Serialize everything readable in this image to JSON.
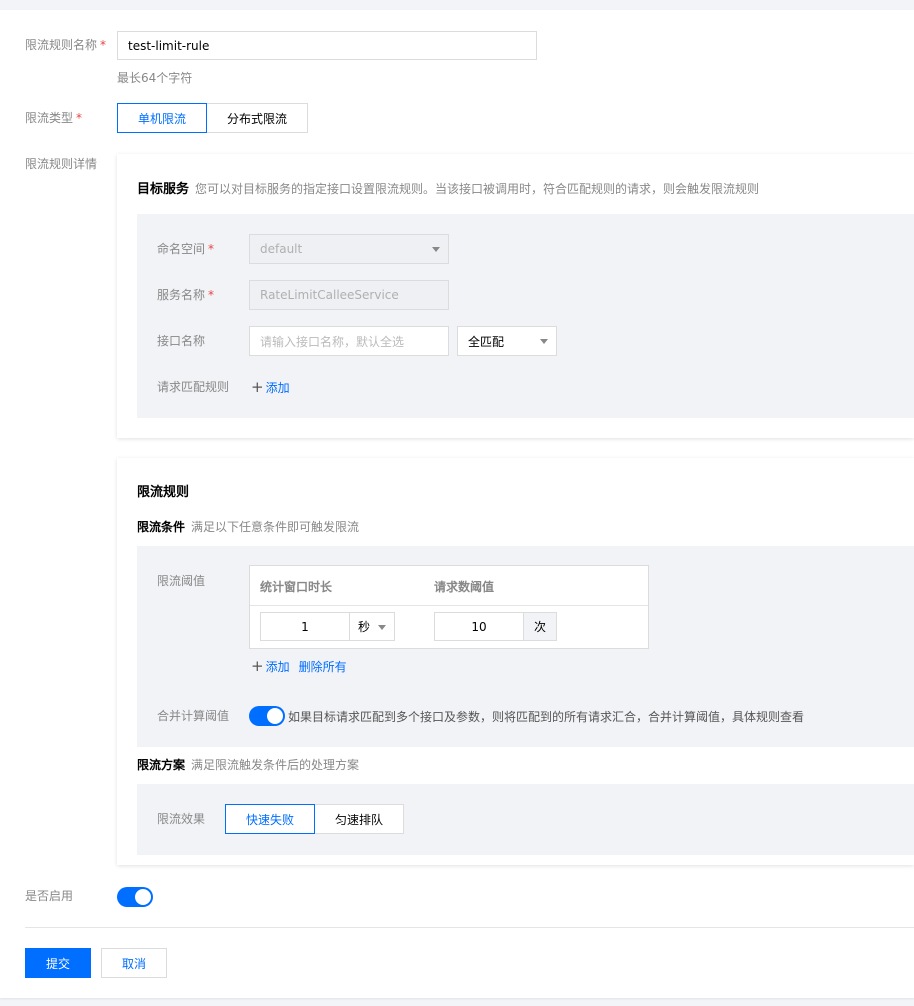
{
  "form": {
    "rule_name_label": "限流规则名称",
    "required_mark": "*",
    "rule_name_value": "test-limit-rule",
    "rule_name_hint": "最长64个字符",
    "limit_type_label": "限流类型",
    "limit_type_options": [
      "单机限流",
      "分布式限流"
    ],
    "limit_type_selected": "单机限流",
    "rule_detail_label": "限流规则详情",
    "enabled_label": "是否启用",
    "enabled": true,
    "submit_label": "提交",
    "cancel_label": "取消"
  },
  "target_service": {
    "title": "目标服务",
    "description": "您可以对目标服务的指定接口设置限流规则。当该接口被调用时，符合匹配规则的请求，则会触发限流规则",
    "namespace_label": "命名空间",
    "namespace_value": "default",
    "service_label": "服务名称",
    "service_value": "RateLimitCalleeService",
    "interface_label": "接口名称",
    "interface_placeholder": "请输入接口名称，默认全选",
    "match_mode": "全匹配",
    "request_match_label": "请求匹配规则",
    "add_label": "添加"
  },
  "limit_rule": {
    "title": "限流规则",
    "condition_title": "限流条件",
    "condition_desc": "满足以下任意条件即可触发限流",
    "threshold_label": "限流阈值",
    "col_window": "统计窗口时长",
    "col_requests": "请求数阈值",
    "window_value": "1",
    "window_unit": "秒",
    "request_value": "10",
    "request_unit": "次",
    "add_label": "添加",
    "delete_all_label": "删除所有",
    "merge_label": "合并计算阈值",
    "merge_enabled": true,
    "merge_desc": "如果目标请求匹配到多个接口及参数，则将匹配到的所有请求汇合，合并计算阈值，具体规则查看",
    "plan_title": "限流方案",
    "plan_desc": "满足限流触发条件后的处理方案",
    "effect_label": "限流效果",
    "effect_options": [
      "快速失败",
      "匀速排队"
    ],
    "effect_selected": "快速失败"
  },
  "colors": {
    "accent": "#006eff",
    "required": "#e54545"
  }
}
